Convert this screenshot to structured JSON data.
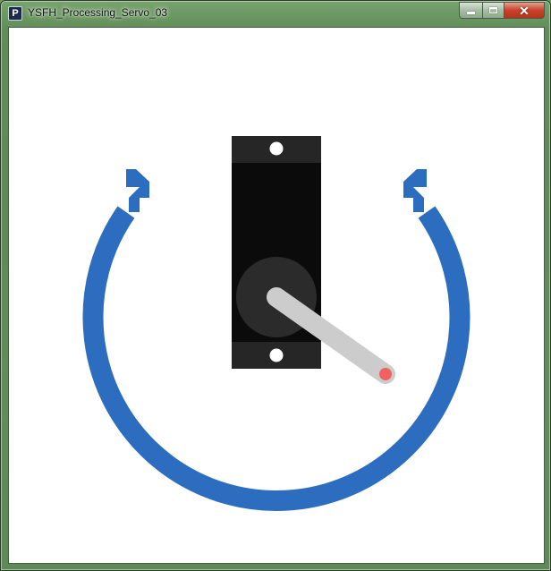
{
  "window": {
    "title": "YSFH_Processing_Servo_03",
    "app_icon_letter": "P",
    "controls": {
      "minimize_icon": "minimize-icon",
      "maximize_icon": "maximize-icon",
      "close_icon": "close-icon",
      "close_glyph": "✕"
    }
  },
  "sketch": {
    "background_color": "#ffffff",
    "arc_color": "#2d6dbf",
    "servo_body_color": "#0b0b0b",
    "servo_tab_color": "#262626",
    "hub_color": "#2b2b2b",
    "horn_color": "#cccccc",
    "horn_tip_color": "#f06262",
    "hole_color": "#ffffff"
  }
}
